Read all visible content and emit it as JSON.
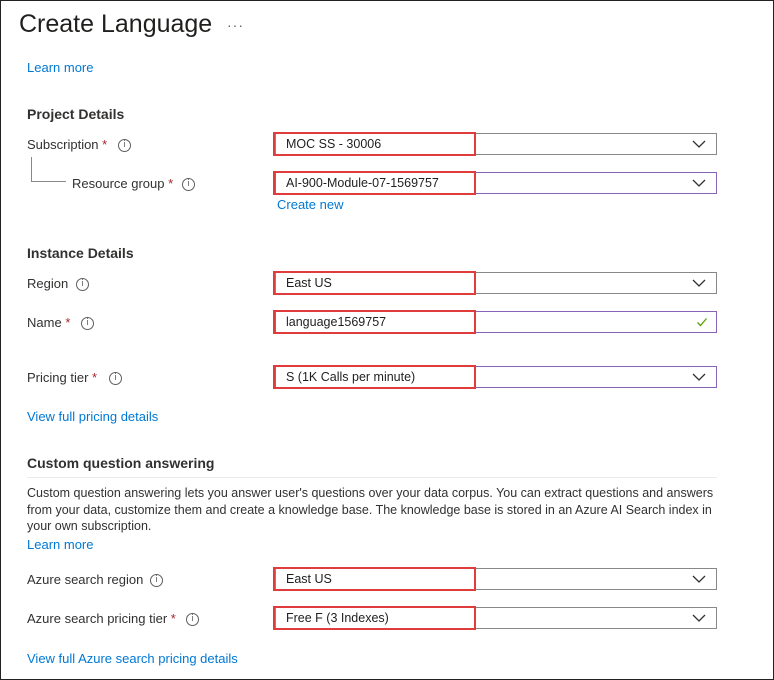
{
  "title": "Create Language",
  "more_label": "···",
  "learn_more_top": "Learn more",
  "project_details": {
    "heading": "Project Details",
    "subscription_label": "Subscription",
    "subscription_value": "MOC SS - 30006",
    "resource_group_label": "Resource group",
    "resource_group_value": "AI-900-Module-07-1569757",
    "create_new": "Create new"
  },
  "instance_details": {
    "heading": "Instance Details",
    "region_label": "Region",
    "region_value": "East US",
    "name_label": "Name",
    "name_value": "language1569757",
    "pricing_label": "Pricing tier",
    "pricing_value": "S (1K Calls per minute)",
    "pricing_link": "View full pricing details"
  },
  "cqa": {
    "heading": "Custom question answering",
    "description": "Custom question answering lets you answer user's questions over your data corpus. You can extract questions and answers from your data, customize them and create a knowledge base. The knowledge base is stored in an Azure AI Search index in your own subscription.",
    "learn_more": "Learn more",
    "search_region_label": "Azure search region",
    "search_region_value": "East US",
    "search_tier_label": "Azure search pricing tier",
    "search_tier_value": "Free F (3 Indexes)",
    "search_pricing_link": "View full Azure search pricing details"
  },
  "required_mark": "*",
  "info_glyph": "i",
  "colors": {
    "link": "#0078d4",
    "highlight": "#e03c3c",
    "required": "#a4262c",
    "focused_border": "#8764b8",
    "valid_check": "#57a300"
  }
}
